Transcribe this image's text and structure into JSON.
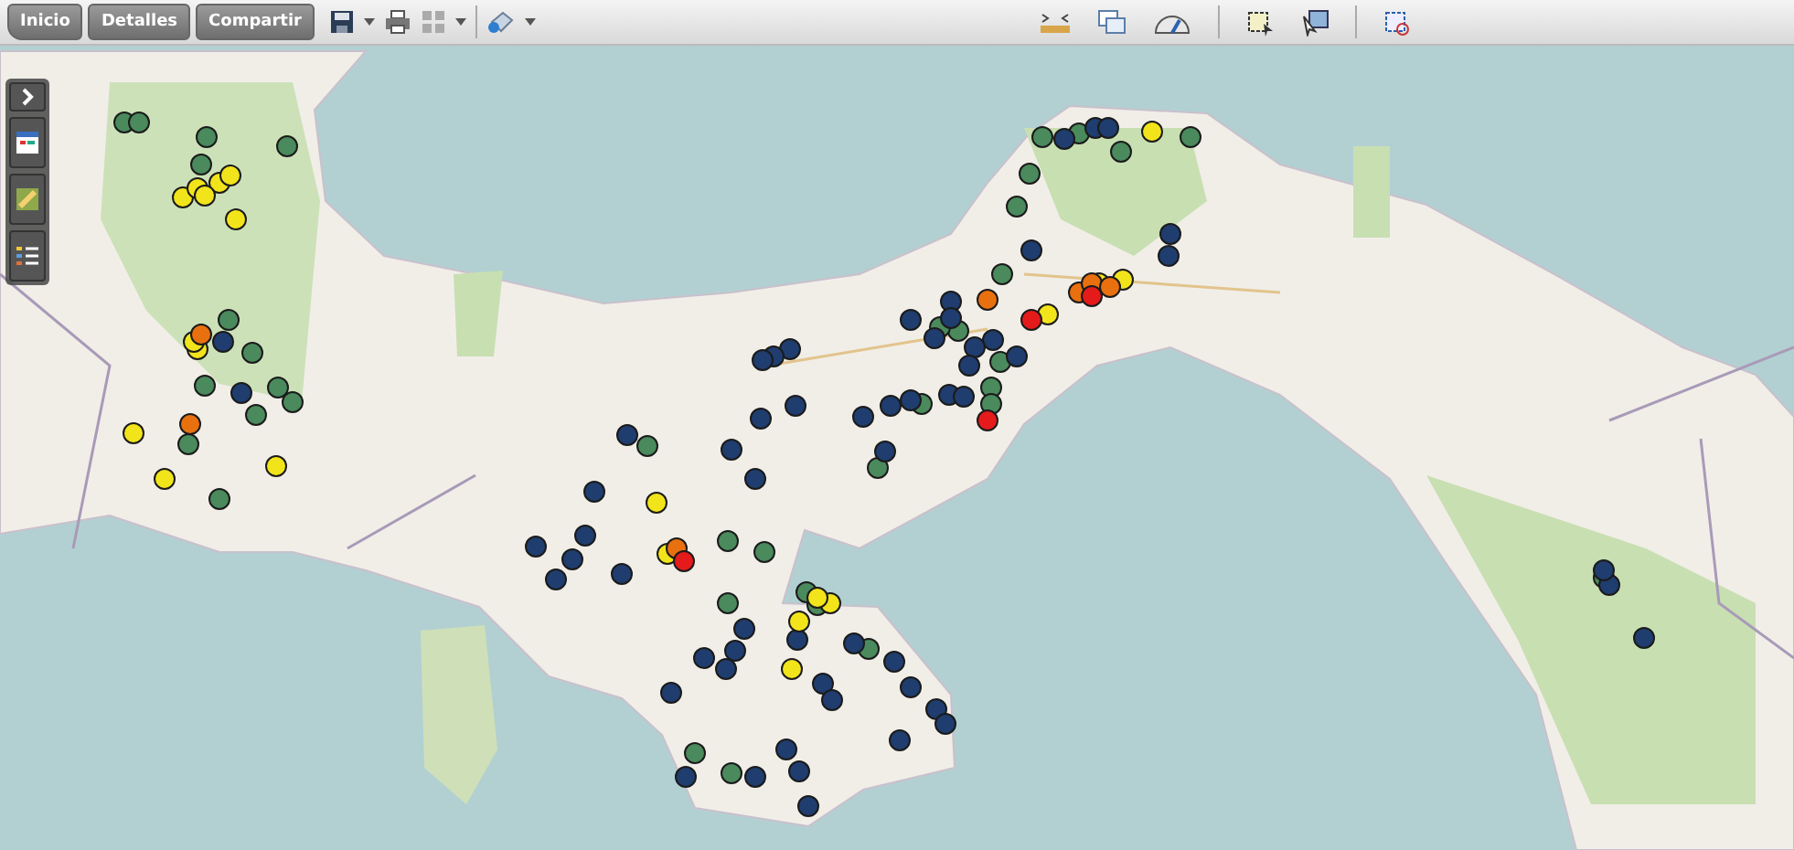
{
  "toolbar": {
    "buttons": [
      "Inicio",
      "Detalles",
      "Compartir"
    ]
  },
  "markers": [
    {
      "color": "#4a8a5c"
    },
    {
      "color": "#4a8a5c"
    },
    {
      "color": "#4a8a5c"
    },
    {
      "color": "#4a8a5c"
    },
    {
      "color": "#4a8a5c"
    },
    {
      "color": "#4a8a5c"
    },
    {
      "color": "#4a8a5c"
    },
    {
      "color": "#4a8a5c"
    },
    {
      "color": "#4a8a5c"
    },
    {
      "color": "#4a8a5c"
    },
    {
      "color": "#4a8a5c"
    },
    {
      "color": "#4a8a5c"
    },
    {
      "color": "#4a8a5c"
    },
    {
      "color": "#4a8a5c"
    },
    {
      "color": "#4a8a5c"
    },
    {
      "color": "#4a8a5c"
    },
    {
      "color": "#4a8a5c"
    },
    {
      "color": "#4a8a5c"
    },
    {
      "color": "#4a8a5c"
    },
    {
      "color": "#4a8a5c"
    },
    {
      "color": "#4a8a5c"
    },
    {
      "color": "#4a8a5c"
    },
    {
      "color": "#4a8a5c"
    },
    {
      "color": "#4a8a5c"
    },
    {
      "color": "#4a8a5c"
    },
    {
      "color": "#4a8a5c"
    },
    {
      "color": "#4a8a5c"
    },
    {
      "color": "#4a8a5c"
    },
    {
      "color": "#4a8a5c"
    },
    {
      "color": "#4a8a5c"
    },
    {
      "color": "#4a8a5c"
    },
    {
      "color": "#4a8a5c"
    },
    {
      "color": "#4a8a5c"
    },
    {
      "color": "#4a8a5c"
    },
    {
      "color": "#4a8a5c"
    },
    {
      "color": "#4a8a5c"
    },
    {
      "color": "#4a8a5c"
    },
    {
      "color": "#1f3d6e"
    },
    {
      "color": "#1f3d6e"
    },
    {
      "color": "#1f3d6e"
    },
    {
      "color": "#1f3d6e"
    },
    {
      "color": "#1f3d6e"
    },
    {
      "color": "#1f3d6e"
    },
    {
      "color": "#1f3d6e"
    },
    {
      "color": "#1f3d6e"
    },
    {
      "color": "#1f3d6e"
    },
    {
      "color": "#1f3d6e"
    },
    {
      "color": "#1f3d6e"
    },
    {
      "color": "#1f3d6e"
    },
    {
      "color": "#1f3d6e"
    },
    {
      "color": "#1f3d6e"
    },
    {
      "color": "#1f3d6e"
    },
    {
      "color": "#1f3d6e"
    },
    {
      "color": "#1f3d6e"
    },
    {
      "color": "#1f3d6e"
    },
    {
      "color": "#1f3d6e"
    },
    {
      "color": "#1f3d6e"
    },
    {
      "color": "#1f3d6e"
    },
    {
      "color": "#1f3d6e"
    },
    {
      "color": "#1f3d6e"
    },
    {
      "color": "#1f3d6e"
    },
    {
      "color": "#1f3d6e"
    },
    {
      "color": "#1f3d6e"
    },
    {
      "color": "#1f3d6e"
    },
    {
      "color": "#1f3d6e"
    },
    {
      "color": "#1f3d6e"
    },
    {
      "color": "#1f3d6e"
    },
    {
      "color": "#1f3d6e"
    },
    {
      "color": "#1f3d6e"
    },
    {
      "color": "#1f3d6e"
    },
    {
      "color": "#1f3d6e"
    },
    {
      "color": "#1f3d6e"
    },
    {
      "color": "#1f3d6e"
    },
    {
      "color": "#1f3d6e"
    },
    {
      "color": "#1f3d6e"
    },
    {
      "color": "#1f3d6e"
    },
    {
      "color": "#1f3d6e"
    },
    {
      "color": "#1f3d6e"
    },
    {
      "color": "#1f3d6e"
    },
    {
      "color": "#1f3d6e"
    },
    {
      "color": "#1f3d6e"
    },
    {
      "color": "#1f3d6e"
    },
    {
      "color": "#1f3d6e"
    },
    {
      "color": "#1f3d6e"
    },
    {
      "color": "#1f3d6e"
    },
    {
      "color": "#1f3d6e"
    },
    {
      "color": "#1f3d6e"
    },
    {
      "color": "#1f3d6e"
    },
    {
      "color": "#1f3d6e"
    },
    {
      "color": "#1f3d6e"
    },
    {
      "color": "#1f3d6e"
    },
    {
      "color": "#1f3d6e"
    },
    {
      "color": "#1f3d6e"
    },
    {
      "color": "#1f3d6e"
    },
    {
      "color": "#1f3d6e"
    },
    {
      "color": "#f2e41a"
    },
    {
      "color": "#f2e41a"
    },
    {
      "color": "#f2e41a"
    },
    {
      "color": "#f2e41a"
    },
    {
      "color": "#f2e41a"
    },
    {
      "color": "#f2e41a"
    },
    {
      "color": "#f2e41a"
    },
    {
      "color": "#f2e41a"
    },
    {
      "color": "#f2e41a"
    },
    {
      "color": "#f2e41a"
    },
    {
      "color": "#f2e41a"
    },
    {
      "color": "#f2e41a"
    },
    {
      "color": "#f2e41a"
    },
    {
      "color": "#f2e41a"
    },
    {
      "color": "#f2e41a"
    },
    {
      "color": "#f2e41a"
    },
    {
      "color": "#f2e41a"
    },
    {
      "color": "#f2e41a"
    },
    {
      "color": "#f2e41a"
    },
    {
      "color": "#f2e41a"
    },
    {
      "color": "#f2e41a"
    },
    {
      "color": "#e8700f"
    },
    {
      "color": "#e8700f"
    },
    {
      "color": "#e8700f"
    },
    {
      "color": "#e8700f"
    },
    {
      "color": "#e8700f"
    },
    {
      "color": "#e8700f"
    },
    {
      "color": "#e8700f"
    },
    {
      "color": "#e51a1a"
    },
    {
      "color": "#e51a1a"
    },
    {
      "color": "#e51a1a"
    },
    {
      "color": "#e51a1a"
    }
  ]
}
